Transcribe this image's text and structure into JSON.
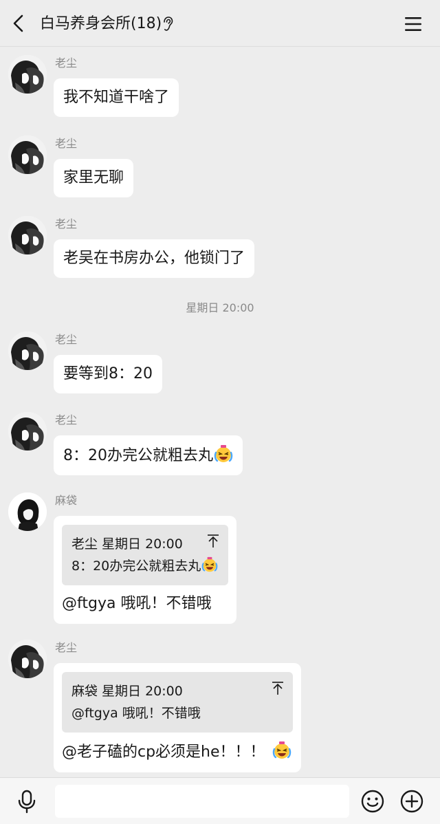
{
  "header": {
    "title": "白马养身会所(18)",
    "back_icon": "chevron-left-icon",
    "mode_icon": "ear-icon",
    "menu_icon": "hamburger-menu-icon"
  },
  "messages": [
    {
      "sender": "老尘",
      "avatar": "manga-avatar",
      "text": "我不知道干啥了"
    },
    {
      "sender": "老尘",
      "avatar": "manga-avatar",
      "text": "家里无聊"
    },
    {
      "sender": "老尘",
      "avatar": "manga-avatar",
      "text": "老吴在书房办公，他锁门了"
    },
    {
      "sender": "老尘",
      "avatar": "manga-avatar",
      "text": "要等到8：20"
    },
    {
      "sender": "老尘",
      "avatar": "manga-avatar",
      "text": "8：20办完公就粗去丸",
      "emoji": "laughing-crying-emoji"
    },
    {
      "sender": "麻袋",
      "avatar": "dark-hair-avatar",
      "quote": {
        "header": "老尘 星期日 20:00",
        "text": "8：20办完公就粗去丸",
        "emoji": "laughing-crying-emoji"
      },
      "text": "@ftgya 哦吼！不错哦"
    },
    {
      "sender": "老尘",
      "avatar": "manga-avatar",
      "quote": {
        "header": "麻袋 星期日 20:00",
        "text": "@ftgya 哦吼！不错哦"
      },
      "text": "@老子磕的cp必须是he！！！",
      "emoji": "laughing-crying-emoji"
    }
  ],
  "timestamp": "星期日 20:00",
  "input": {
    "value": "",
    "placeholder": ""
  },
  "bottom_icons": [
    "microphone-icon",
    "smiley-icon",
    "plus-icon"
  ],
  "colors": {
    "background": "#ededed",
    "bubble": "#ffffff",
    "quote": "#e6e6e6",
    "meta_text": "#8a8a8a"
  }
}
